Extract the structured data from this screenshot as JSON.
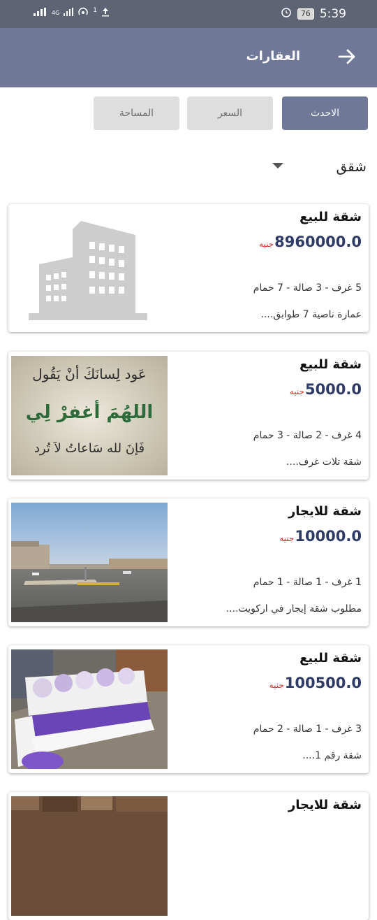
{
  "status_bar": {
    "network": "4G",
    "sim_indicator": "1",
    "battery": "76",
    "time": "5:39",
    "icons": [
      "signal-icon",
      "hotspot-icon",
      "upload-icon",
      "alarm-icon",
      "battery-icon"
    ]
  },
  "appbar": {
    "title": "العقارات",
    "back_icon": "arrow-right-icon"
  },
  "filters": {
    "newest": "الاحدث",
    "price": "السعر",
    "area": "المساحة",
    "active": "newest"
  },
  "dropdown": {
    "value": "شقق"
  },
  "listings": [
    {
      "title": "شقة للبيع",
      "price": "8960000.0",
      "currency": "جنيه",
      "rooms": "5 غرف - 3 صالة - 7 حمام",
      "desc": "عمارة ناصية 7 طوابق....",
      "image": "building-placeholder-icon"
    },
    {
      "title": "شقة للبيع",
      "price": "5000.0",
      "currency": "جنيه",
      "rooms": "4 غرف - 2 صالة - 3 حمام",
      "desc": "شقة تلات غرف....",
      "image": "calligraphy-photo"
    },
    {
      "title": "شقة للايجار",
      "price": "10000.0",
      "currency": "جنيه",
      "rooms": "1 غرف - 1 صالة - 1 حمام",
      "desc": "مطلوب شقة إيجار في اركويت....",
      "image": "street-photo"
    },
    {
      "title": "شقة للبيع",
      "price": "100500.0",
      "currency": "جنيه",
      "rooms": "3 غرف - 1 صالة - 2 حمام",
      "desc": "شقة رقم 1....",
      "image": "sofa-photo"
    },
    {
      "title": "شقة للايجار",
      "image": "stone-wall-photo"
    }
  ],
  "calligraphy": {
    "line1": "عَود لِسانَكَ أنْ يَقُول",
    "line2": "اللهُمَ أغفرْ لِي",
    "line3": "فَإنَ لله سَاعاتُ لاَ تُرد"
  },
  "colors": {
    "appbar": "#6f7897",
    "statusbar": "#5f6474",
    "price": "#2f3a66",
    "currency": "#c9302c"
  }
}
